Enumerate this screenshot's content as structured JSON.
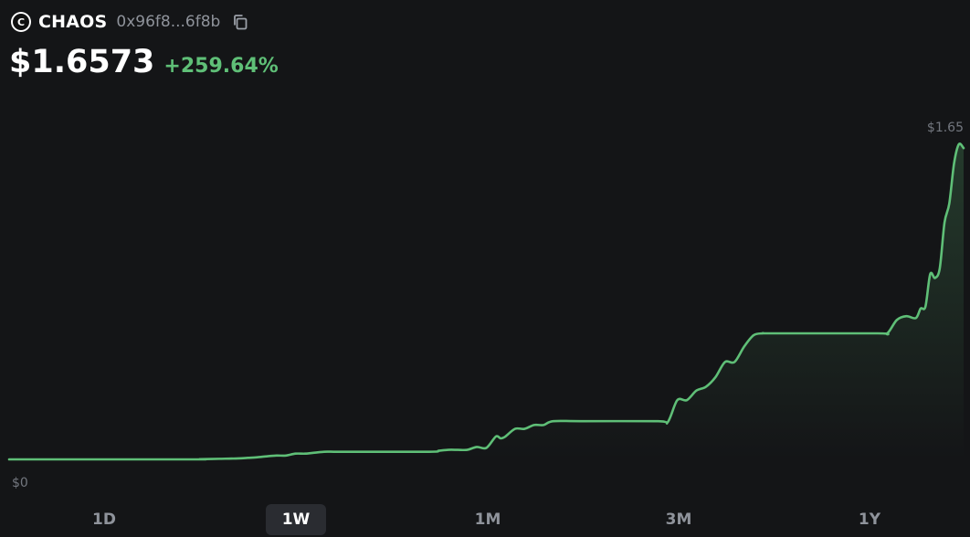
{
  "token": {
    "logo_letter": "C",
    "symbol": "CHAOS",
    "address": "0x96f8...6f8b",
    "price": "$1.6573",
    "change": "+259.64%"
  },
  "colors": {
    "accent_green": "#5fbf77",
    "muted": "#8f939b",
    "background": "#141517"
  },
  "icons": {
    "copy": "copy-icon"
  },
  "chart_data": {
    "type": "area",
    "x_normalized": [
      0.0,
      0.19,
      0.2,
      0.22,
      0.24,
      0.25,
      0.26,
      0.27,
      0.28,
      0.29,
      0.3,
      0.31,
      0.32,
      0.33,
      0.34,
      0.35,
      0.44,
      0.45,
      0.46,
      0.47,
      0.48,
      0.49,
      0.5,
      0.51,
      0.515,
      0.52,
      0.53,
      0.54,
      0.55,
      0.56,
      0.57,
      0.6,
      0.68,
      0.69,
      0.7,
      0.71,
      0.72,
      0.73,
      0.74,
      0.75,
      0.76,
      0.77,
      0.78,
      0.79,
      0.8,
      0.91,
      0.92,
      0.93,
      0.94,
      0.95,
      0.955,
      0.96,
      0.965,
      0.97,
      0.975,
      0.98,
      0.985,
      0.99,
      0.995,
      1.0
    ],
    "values": [
      0.0,
      0.0,
      0.001,
      0.003,
      0.005,
      0.008,
      0.011,
      0.016,
      0.02,
      0.02,
      0.03,
      0.03,
      0.035,
      0.04,
      0.04,
      0.04,
      0.04,
      0.045,
      0.05,
      0.05,
      0.05,
      0.065,
      0.06,
      0.12,
      0.11,
      0.12,
      0.16,
      0.16,
      0.18,
      0.18,
      0.2,
      0.2,
      0.2,
      0.195,
      0.31,
      0.31,
      0.36,
      0.38,
      0.43,
      0.51,
      0.51,
      0.59,
      0.65,
      0.66,
      0.66,
      0.66,
      0.66,
      0.73,
      0.75,
      0.74,
      0.79,
      0.8,
      0.97,
      0.95,
      1.0,
      1.24,
      1.34,
      1.55,
      1.65,
      1.63
    ],
    "y_top_label": "$1.65",
    "y_bottom_label": "$0",
    "ylim": [
      0,
      1.65
    ],
    "ranges": [
      "1D",
      "1W",
      "1M",
      "3M",
      "1Y"
    ],
    "selected_range": "1W"
  }
}
